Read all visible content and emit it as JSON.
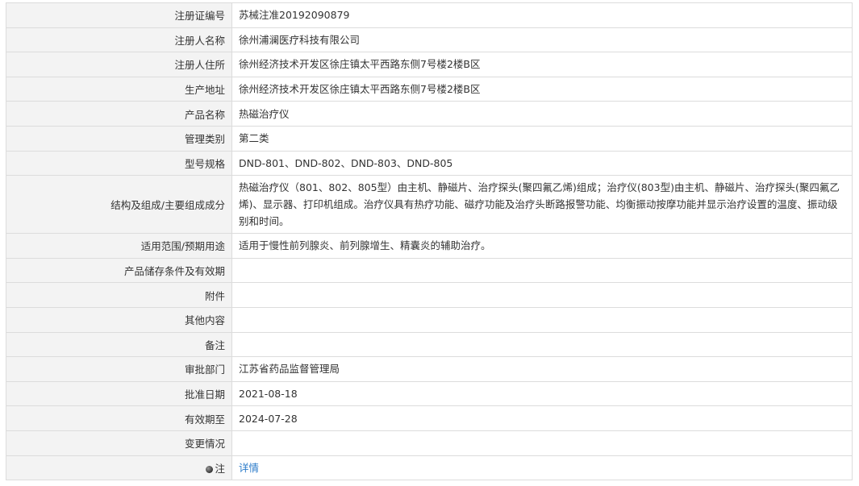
{
  "rows": [
    {
      "label": "注册证编号",
      "value": "苏械注准20192090879"
    },
    {
      "label": "注册人名称",
      "value": "徐州浦澜医疗科技有限公司"
    },
    {
      "label": "注册人住所",
      "value": "徐州经济技术开发区徐庄镇太平西路东侧7号楼2楼B区"
    },
    {
      "label": "生产地址",
      "value": "徐州经济技术开发区徐庄镇太平西路东侧7号楼2楼B区"
    },
    {
      "label": "产品名称",
      "value": "热磁治疗仪"
    },
    {
      "label": "管理类别",
      "value": "第二类"
    },
    {
      "label": "型号规格",
      "value": "DND-801、DND-802、DND-803、DND-805"
    },
    {
      "label": "结构及组成/主要组成成分",
      "value": "热磁治疗仪（801、802、805型）由主机、静磁片、治疗探头(聚四氟乙烯)组成；治疗仪(803型)由主机、静磁片、治疗探头(聚四氟乙烯)、显示器、打印机组成。治疗仪具有热疗功能、磁疗功能及治疗头断路报警功能、均衡振动按摩功能并显示治疗设置的温度、振动级别和时间。"
    },
    {
      "label": "适用范围/预期用途",
      "value": "适用于慢性前列腺炎、前列腺增生、精囊炎的辅助治疗。"
    },
    {
      "label": "产品储存条件及有效期",
      "value": ""
    },
    {
      "label": "附件",
      "value": ""
    },
    {
      "label": "其他内容",
      "value": ""
    },
    {
      "label": "备注",
      "value": ""
    },
    {
      "label": "审批部门",
      "value": "江苏省药品监督管理局"
    },
    {
      "label": "批准日期",
      "value": "2021-08-18"
    },
    {
      "label": "有效期至",
      "value": "2024-07-28"
    },
    {
      "label": "变更情况",
      "value": ""
    }
  ],
  "note": {
    "label": "注",
    "icon": "info-dot-icon",
    "link_text": "详情",
    "link_color": "#2b7bc9"
  }
}
